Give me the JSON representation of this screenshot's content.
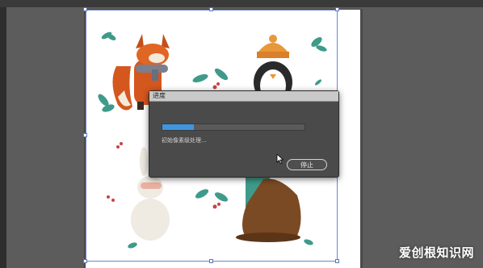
{
  "dialog": {
    "title": "进度",
    "progress_fraction": 0.22,
    "status": "初始像素级处理...",
    "stop_label": "停止"
  },
  "colors": {
    "progress_fill": "#3f95df",
    "workspace": "#5c5c5c",
    "dialog_body": "#4a4a4a",
    "selection_border": "#6b87c9"
  },
  "watermark": {
    "text": "爱创根知识网"
  }
}
